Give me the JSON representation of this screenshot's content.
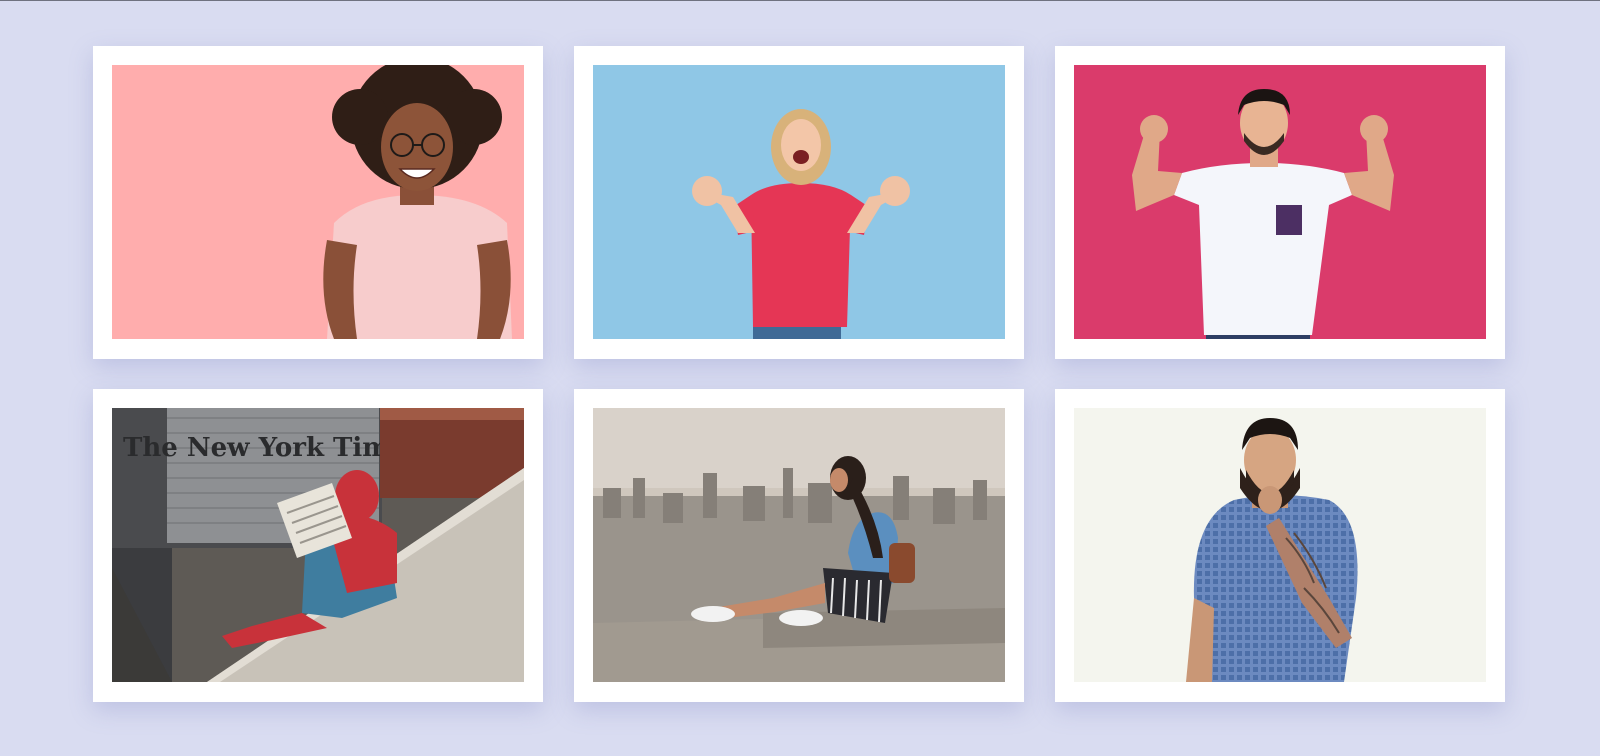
{
  "gallery": {
    "photos": [
      {
        "subject": "smiling woman with curly hair and glasses in pink t-shirt",
        "background": "#ffadad"
      },
      {
        "subject": "laughing woman in red polo shirt raising hands",
        "background": "#8fc7e6"
      },
      {
        "subject": "man in white t-shirt flexing both arms",
        "background": "#da3b6b"
      },
      {
        "subject": "spider-man costume reading newspaper on ledge",
        "background": "#8c8c8c",
        "sign_text": "The New York Times"
      },
      {
        "subject": "woman sitting on rooftop ledge overlooking hazy city",
        "background": "#cfc7bd"
      },
      {
        "subject": "bearded man in blue checked shirt with tattooed arm",
        "background": "#f4f5ee"
      }
    ]
  }
}
